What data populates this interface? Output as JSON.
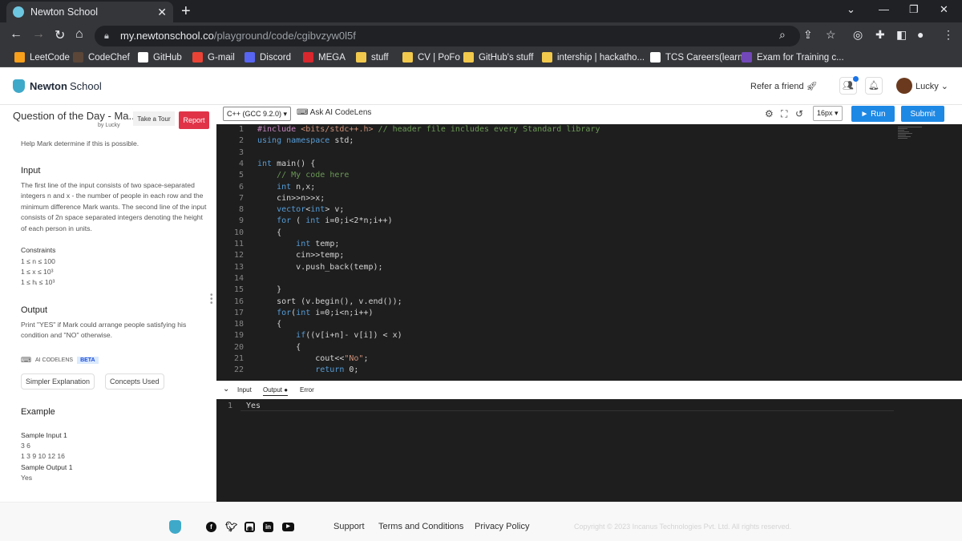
{
  "browser": {
    "tab_title": "Newton School",
    "tab_close": "✕",
    "new_tab": "+",
    "url_host": "my.newtonschool.co",
    "url_path": "/playground/code/cgibvzyw0l5f",
    "bookmarks": [
      {
        "label": "LeetCode",
        "icon": "leetcode-icon",
        "color": "#f89f1b"
      },
      {
        "label": "CodeChef",
        "icon": "codechef-icon",
        "color": "#5b4638"
      },
      {
        "label": "GitHub",
        "icon": "github-icon",
        "color": "#ffffff"
      },
      {
        "label": "G-mail",
        "icon": "gmail-icon",
        "color": "#ea4335"
      },
      {
        "label": "Discord",
        "icon": "discord-icon",
        "color": "#5865f2"
      },
      {
        "label": "MEGA",
        "icon": "mega-icon",
        "color": "#d9272e"
      },
      {
        "label": "stuff",
        "icon": "folder-icon",
        "color": "#f2c94c"
      },
      {
        "label": "CV | PoFo",
        "icon": "folder-icon",
        "color": "#f2c94c"
      },
      {
        "label": "GitHub's stuff",
        "icon": "folder-icon",
        "color": "#f2c94c"
      },
      {
        "label": "intership | hackatho...",
        "icon": "folder-icon",
        "color": "#f2c94c"
      },
      {
        "label": "TCS Careers(learn)",
        "icon": "tcs-icon",
        "color": "#ffffff"
      },
      {
        "label": "Exam for Training c...",
        "icon": "forms-icon",
        "color": "#7248b9"
      }
    ]
  },
  "header": {
    "logo_bold": "Newton",
    "logo_rest": "School",
    "refer": "Refer a friend",
    "user": "Lucky"
  },
  "problem": {
    "title": "Question of the Day - Ma...",
    "byline": "by Lucky",
    "tour_label": "Take a Tour",
    "report_label": "Report",
    "intro": "Help Mark determine if this is possible.",
    "input_heading": "Input",
    "input_text": "The first line of the input consists of two space-separated integers n and x - the number of people in each row and the minimum difference Mark wants. The second line of the input consists of 2n space separated integers denoting the height of each person in units.",
    "constraints_heading": "Constraints",
    "constraints": [
      "1 ≤ n ≤ 100",
      "1 ≤ x ≤ 10³",
      "1 ≤ hᵢ ≤ 10³"
    ],
    "output_heading": "Output",
    "output_text": "Print \"YES\" if Mark could arrange people satisfying his condition and \"NO\" otherwise.",
    "ai_label": "AI CODELENS",
    "beta": "BETA",
    "chip1": "Simpler Explanation",
    "chip2": "Concepts Used",
    "example_heading": "Example",
    "sample_input_label": "Sample Input 1",
    "sample_input_line1": "3 6",
    "sample_input_line2": "1 3 9 10 12 16",
    "sample_output_label": "Sample Output 1",
    "sample_output": "Yes"
  },
  "editor": {
    "language": "C++ (GCC 9.2.0) ▾",
    "ask_ai": "Ask AI CodeLens",
    "font_size": "16px ▾",
    "run_label": "► Run",
    "submit_label": "Submit",
    "lines": [
      "#include <bits/stdc++.h> // header file includes every Standard library",
      "using namespace std;",
      "",
      "int main() {",
      "    // My code here",
      "    int n,x;",
      "    cin>>n>>x;",
      "    vector<int> v;",
      "    for ( int i=0;i<2*n;i++)",
      "    {",
      "        int temp;",
      "        cin>>temp;",
      "        v.push_back(temp);",
      "",
      "    }",
      "    sort (v.begin(), v.end());",
      "    for(int i=0;i<n;i++)",
      "    {",
      "        if((v[i+n]- v[i]) < x)",
      "        {",
      "            cout<<\"No\";",
      "            return 0;"
    ]
  },
  "output_panel": {
    "tabs": [
      "Input",
      "Output",
      "Error"
    ],
    "line_number": "1",
    "result": "Yes"
  },
  "footer": {
    "support": "Support",
    "terms": "Terms and Conditions",
    "privacy": "Privacy Policy",
    "copyright": "Copyright © 2023 Incanus Technologies Pvt. Ltd. All rights reserved."
  }
}
